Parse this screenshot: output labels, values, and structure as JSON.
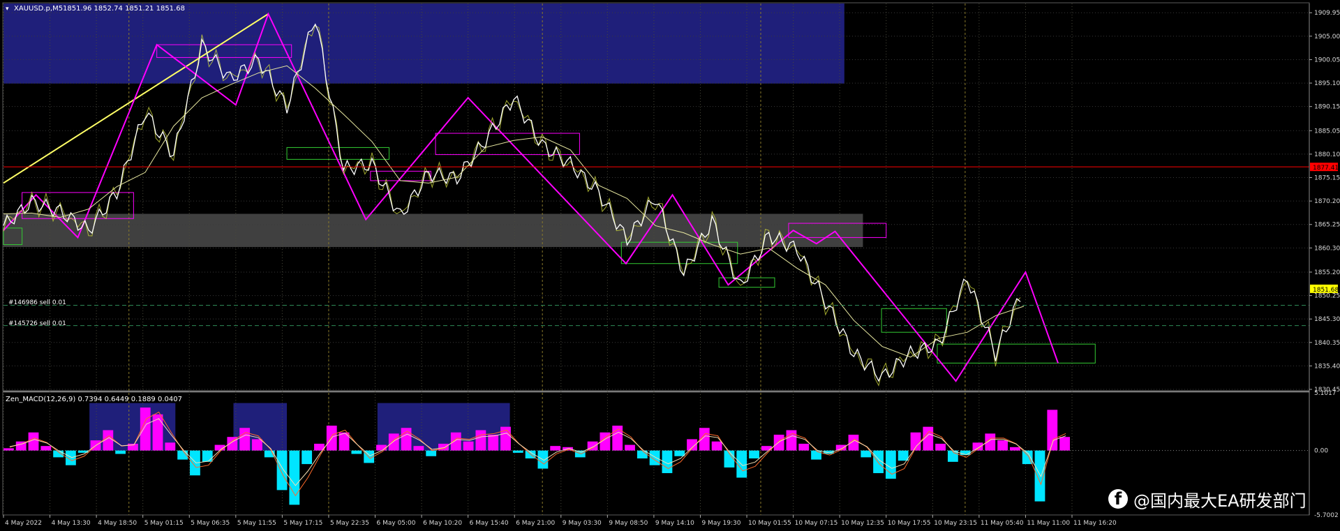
{
  "window": {
    "title": "XAUUSD.p,M5",
    "ohlc": "1851.96 1852.74 1851.21 1851.68"
  },
  "colors": {
    "background": "#000000",
    "grid": "#5a5a3a",
    "supply_zone": "#1f1f7a",
    "demand_zone": "#404040",
    "zigzag_primary": "#ff00ff",
    "zigzag_secondary": "#ffffff",
    "trendline": "#ffff66",
    "resistance_line": "#ff0000",
    "order_line": "#2e8b57",
    "macd_positive": "#ff00ff",
    "macd_negative": "#00e5ff",
    "price_badge": "#ffff00"
  },
  "orders": [
    {
      "label": "#146986 sell 0.01",
      "price": 1848.2
    },
    {
      "label": "#145726 sell 0.01",
      "price": 1843.9
    }
  ],
  "indicator": {
    "title": "Zen_MACD(12,26,9) 0.7394 0.6449 0.1889 0.0407",
    "axis_labels": [
      "5.1017",
      "0.00",
      "-5.7002"
    ]
  },
  "current_price_label": "1851.68",
  "resistance_price_label": "1877.41",
  "watermark": {
    "icon": "facebook-icon",
    "text": "@国内最大EA研发部门"
  },
  "chart_data": [
    {
      "type": "line",
      "title": "XAUUSD.p,M5",
      "x": [
        "4 May 2022",
        "4 May 13:30",
        "4 May 18:50",
        "5 May 01:15",
        "5 May 06:35",
        "5 May 11:55",
        "5 May 17:15",
        "5 May 22:35",
        "6 May 05:00",
        "6 May 10:20",
        "6 May 15:40",
        "6 May 21:00",
        "9 May 03:30",
        "9 May 08:50",
        "9 May 14:10",
        "9 May 19:30",
        "10 May 01:55",
        "10 May 07:15",
        "10 May 12:35",
        "10 May 17:55",
        "10 May 23:15",
        "11 May 05:40",
        "11 May 11:00",
        "11 May 16:20"
      ],
      "y_ticks": [
        "1909.95",
        "1905.00",
        "1900.05",
        "1895.10",
        "1890.15",
        "1885.05",
        "1880.10",
        "1875.15",
        "1870.20",
        "1865.25",
        "1860.30",
        "1855.20",
        "1850.25",
        "1845.30",
        "1840.35",
        "1835.40",
        "1830.45"
      ],
      "ylim": [
        1830.45,
        1911.9
      ],
      "series": [
        {
          "values": [
            1865,
            1870,
            1868,
            1864,
            1872,
            1889,
            1880,
            1903,
            1896,
            1900,
            1890,
            1909,
            1877,
            1878,
            1867,
            1876,
            1875,
            1883,
            1892,
            1882,
            1878,
            1872,
            1862,
            1871,
            1855,
            1866,
            1852,
            1863,
            1860,
            1849,
            1838,
            1833,
            1838,
            1840,
            1854,
            1838,
            1852
          ]
        }
      ],
      "zigzag": [
        {
          "x": 0,
          "y": 1864.0
        },
        {
          "x": 0.7,
          "y": 1871.5
        },
        {
          "x": 1.6,
          "y": 1862.5
        },
        {
          "x": 3.3,
          "y": 1903.2
        },
        {
          "x": 5.0,
          "y": 1890.5
        },
        {
          "x": 5.7,
          "y": 1909.7
        },
        {
          "x": 7.8,
          "y": 1866.3
        },
        {
          "x": 10.0,
          "y": 1892.0
        },
        {
          "x": 13.4,
          "y": 1857.0
        },
        {
          "x": 14.4,
          "y": 1871.5
        },
        {
          "x": 15.6,
          "y": 1852.5
        },
        {
          "x": 17.0,
          "y": 1864.0
        },
        {
          "x": 17.5,
          "y": 1861.2
        },
        {
          "x": 17.9,
          "y": 1863.8
        },
        {
          "x": 20.5,
          "y": 1832.2
        },
        {
          "x": 22.0,
          "y": 1855.2
        },
        {
          "x": 22.7,
          "y": 1836.0
        }
      ],
      "trendline": [
        {
          "x": 0,
          "y": 1874.0
        },
        {
          "x": 5.7,
          "y": 1909.7
        }
      ],
      "supply_zone": {
        "x_from": 0,
        "x_to": 18.1,
        "y_from": 1895.0,
        "y_to": 1911.9
      },
      "demand_zone": {
        "x_from": 0,
        "x_to": 18.5,
        "y_from": 1860.5,
        "y_to": 1867.5
      },
      "resistance_level": 1877.41,
      "current_price": 1851.68
    },
    {
      "type": "bar",
      "title": "Zen_MACD(12,26,9) 0.7394 0.6449 0.1889 0.0407",
      "ylim": [
        -5.7002,
        5.1017
      ],
      "y_ticks": [
        "5.1017",
        "0.00",
        "-5.7002"
      ],
      "histogram": [
        0.2,
        0.8,
        1.6,
        0.4,
        -0.6,
        -1.3,
        -0.2,
        0.9,
        1.8,
        -0.3,
        0.6,
        3.8,
        3.2,
        0.7,
        -0.8,
        -2.2,
        -1.0,
        0.5,
        1.2,
        2.0,
        1.0,
        -0.6,
        -3.5,
        -4.8,
        -1.2,
        0.6,
        2.2,
        1.6,
        -0.3,
        -1.1,
        0.5,
        1.5,
        2.0,
        0.4,
        -0.5,
        0.6,
        1.6,
        0.8,
        1.8,
        1.4,
        2.1,
        -0.2,
        -0.7,
        -1.6,
        0.4,
        0.3,
        -0.6,
        0.8,
        1.6,
        2.2,
        0.5,
        -0.7,
        -1.3,
        -2.0,
        -0.5,
        1.0,
        2.0,
        0.8,
        -1.5,
        -2.4,
        -0.7,
        0.4,
        1.4,
        1.8,
        0.6,
        -0.8,
        -0.3,
        0.5,
        1.4,
        -0.6,
        -2.0,
        -2.5,
        -0.9,
        1.6,
        2.1,
        0.6,
        -1.0,
        -0.4,
        0.7,
        1.5,
        0.9,
        0.3,
        -1.2,
        -4.5,
        3.6,
        1.2
      ],
      "signal_line": [
        0.3,
        0.6,
        1.1,
        0.7,
        -0.2,
        -0.9,
        -0.5,
        0.5,
        1.3,
        0.4,
        0.5,
        2.8,
        3.4,
        1.6,
        -0.1,
        -1.5,
        -1.3,
        0.0,
        0.9,
        1.6,
        1.3,
        0.1,
        -2.2,
        -4.0,
        -2.4,
        -0.4,
        1.4,
        1.8,
        0.5,
        -0.7,
        -0.1,
        1.0,
        1.7,
        1.0,
        0.0,
        0.2,
        1.1,
        1.0,
        1.4,
        1.5,
        1.8,
        0.6,
        -0.4,
        -1.2,
        -0.3,
        0.1,
        -0.3,
        0.3,
        1.2,
        1.9,
        1.2,
        -0.1,
        -0.9,
        -1.6,
        -1.0,
        0.3,
        1.5,
        1.3,
        -0.4,
        -1.8,
        -1.4,
        -0.2,
        0.9,
        1.5,
        1.1,
        -0.1,
        -0.4,
        0.1,
        1.0,
        0.3,
        -1.2,
        -2.1,
        -1.6,
        0.4,
        1.7,
        1.2,
        -0.2,
        -0.6,
        0.2,
        1.1,
        1.1,
        0.6,
        -0.5,
        -3.0,
        1.0,
        1.5
      ]
    }
  ]
}
